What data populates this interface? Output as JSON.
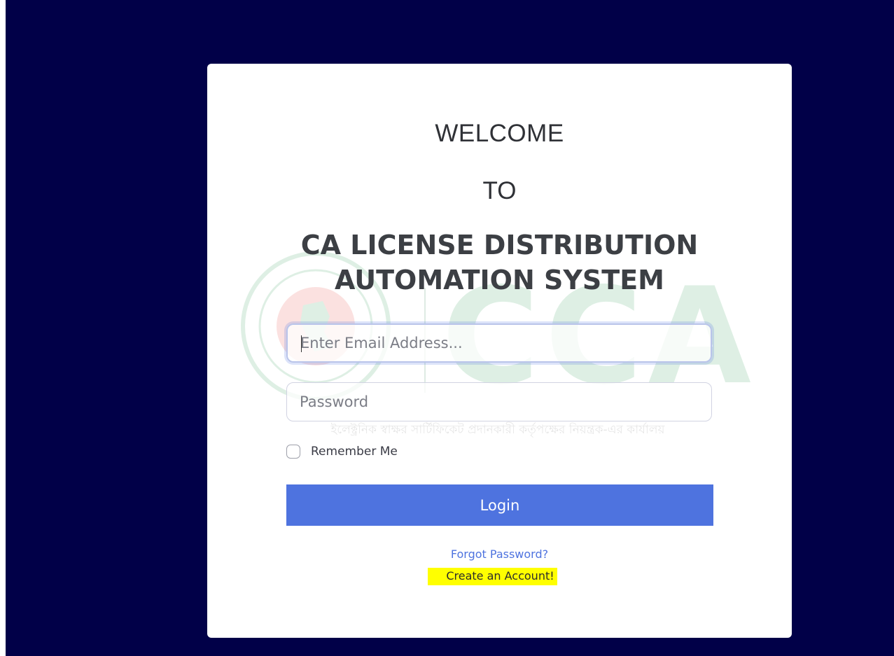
{
  "login_card": {
    "welcome": "WELCOME",
    "to": "TO",
    "system_title_line1": "CA LICENSE DISTRIBUTION",
    "system_title_line2": "AUTOMATION SYSTEM",
    "email_placeholder": "Enter Email Address...",
    "password_placeholder": "Password",
    "remember_label": "Remember Me",
    "login_label": "Login",
    "forgot_label": "Forgot Password?",
    "create_account_label": "Create an Account!"
  },
  "watermark": {
    "logo_text": "CCA",
    "tagline": "ইলেক্ট্রনিক স্বাক্ষর সার্টিফিকেট প্রদানকারী কর্তৃপক্ষের নিয়ন্ত্রক-এর কার্যালয়"
  },
  "colors": {
    "page_background": "#010048",
    "card_background": "#ffffff",
    "primary": "#4e73df",
    "highlight": "#ffff00",
    "watermark_green": "#0a8a3a",
    "watermark_red": "#e2231a"
  },
  "icons": {
    "seal": "government-seal-icon"
  }
}
